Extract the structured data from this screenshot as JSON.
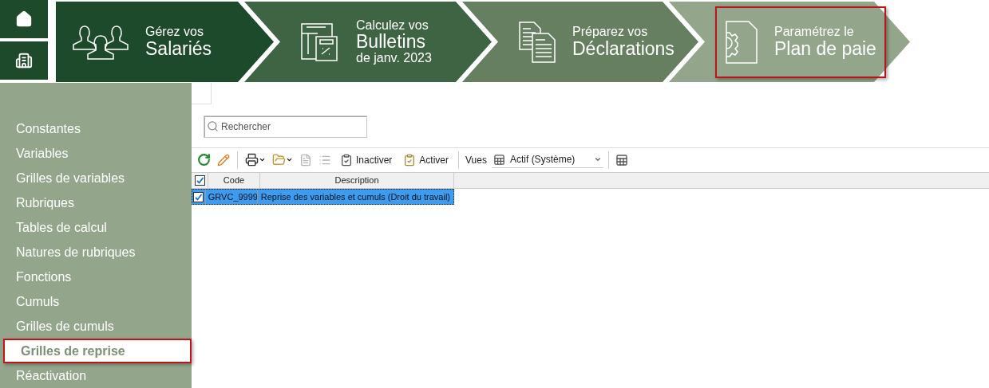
{
  "steps": [
    {
      "line1": "Gérez vos",
      "line2": "Salariés",
      "selected": false
    },
    {
      "line1": "Calculez vos",
      "line2": "Bulletins",
      "line3": "de janv. 2023",
      "selected": false
    },
    {
      "line1": "Préparez vos",
      "line2": "Déclarations",
      "selected": false
    },
    {
      "line1": "Paramétrez le",
      "line2": "Plan de paie",
      "selected": true
    }
  ],
  "sidebar": {
    "items": [
      {
        "label": "Constantes",
        "selected": false
      },
      {
        "label": "Variables",
        "selected": false
      },
      {
        "label": "Grilles de variables",
        "selected": false
      },
      {
        "label": "Rubriques",
        "selected": false
      },
      {
        "label": "Tables de calcul",
        "selected": false
      },
      {
        "label": "Natures de rubriques",
        "selected": false
      },
      {
        "label": "Fonctions",
        "selected": false
      },
      {
        "label": "Cumuls",
        "selected": false
      },
      {
        "label": "Grilles de cumuls",
        "selected": false
      },
      {
        "label": "Grilles de reprise",
        "selected": true
      },
      {
        "label": "Réactivation",
        "selected": false
      }
    ]
  },
  "search": {
    "placeholder": "Rechercher"
  },
  "toolbar": [
    {
      "kind": "refresh"
    },
    {
      "kind": "edit"
    },
    {
      "kind": "sep"
    },
    {
      "kind": "print"
    },
    {
      "kind": "export"
    },
    {
      "kind": "doc",
      "disabled": true
    },
    {
      "kind": "list",
      "disabled": true
    },
    {
      "kind": "button",
      "label": "Inactiver"
    },
    {
      "kind": "button",
      "label": "Activer"
    },
    {
      "kind": "sep"
    }
  ],
  "views": {
    "label": "Vues",
    "value": "Actif (Système)"
  },
  "table": {
    "all_checked": true,
    "columns": [
      "Code",
      "Description"
    ],
    "rows": [
      {
        "checked": true,
        "selected": true,
        "cells": [
          "GRVC_9999",
          "Reprise des variables et cumuls (Droit du travail)"
        ]
      }
    ]
  }
}
